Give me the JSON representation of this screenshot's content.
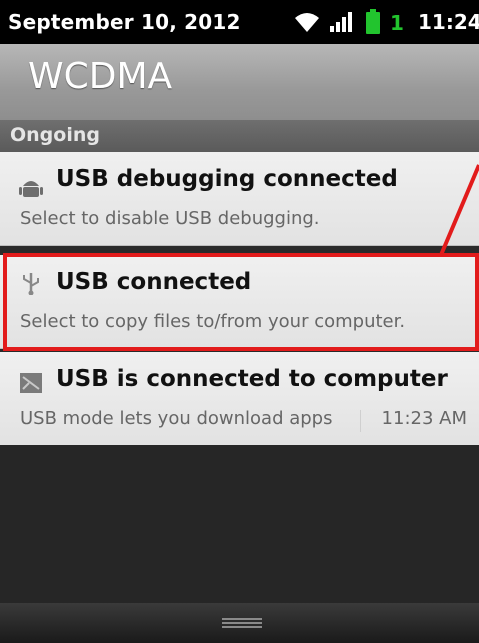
{
  "status_bar": {
    "date": "September 10, 2012",
    "sim_indicator": "1",
    "time": "11:24",
    "icons": [
      "wifi-icon",
      "signal-icon",
      "battery-icon"
    ],
    "battery_color": "#22c42e"
  },
  "operator": {
    "name": "WCDMA"
  },
  "section": {
    "label": "Ongoing"
  },
  "notifications": [
    {
      "icon": "android-debug-icon",
      "title": "USB debugging connected",
      "text": "Select to disable USB debugging."
    },
    {
      "icon": "usb-icon",
      "title": "USB connected",
      "text": "Select to copy files to/from your computer."
    },
    {
      "icon": "usb-mode-icon",
      "title": "USB is connected to computer",
      "text": "USB mode lets you download apps",
      "time": "11:23 AM"
    }
  ],
  "annotation": {
    "color": "#e21b1b"
  }
}
